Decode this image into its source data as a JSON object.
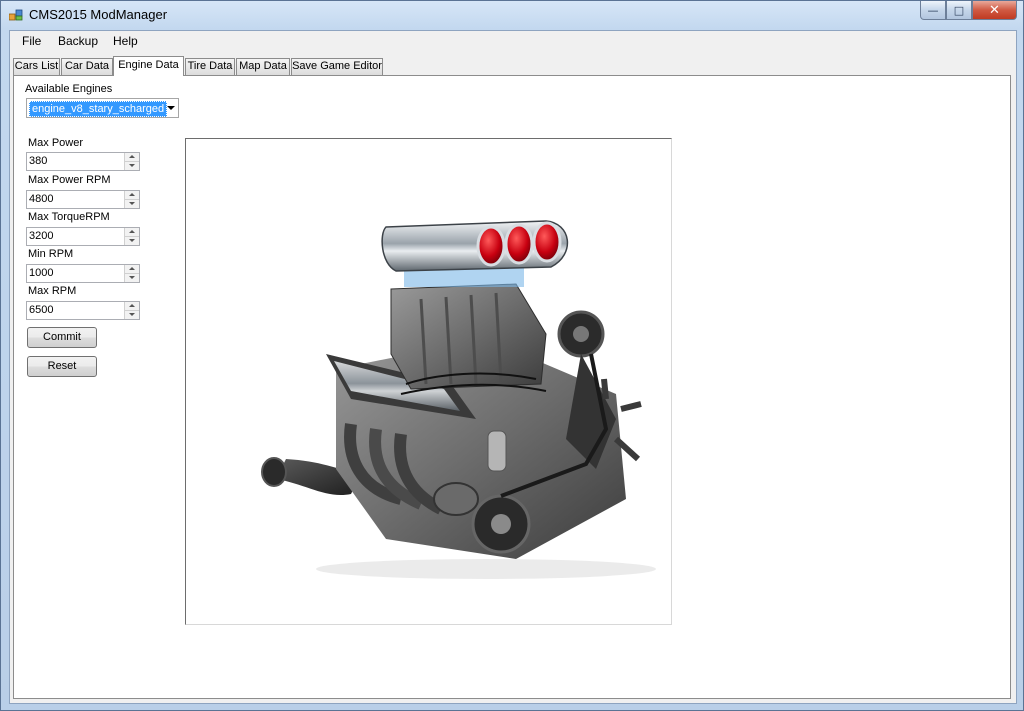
{
  "window": {
    "title": "CMS2015 ModManager"
  },
  "caption_buttons": {
    "minimize": "—",
    "maximize": "□",
    "close": "✕"
  },
  "menu": {
    "items": [
      "File",
      "Backup",
      "Help"
    ]
  },
  "tabs": [
    "Cars List",
    "Car Data",
    "Engine Data",
    "Tire Data",
    "Map Data",
    "Save Game Editor"
  ],
  "active_tab": "Engine Data",
  "engine": {
    "available_label": "Available Engines",
    "selected": "engine_v8_stary_scharged",
    "fields": [
      {
        "label": "Max Power",
        "value": "380"
      },
      {
        "label": "Max Power RPM",
        "value": "4800"
      },
      {
        "label": "Max TorqueRPM",
        "value": "3200"
      },
      {
        "label": "Min RPM",
        "value": "1000"
      },
      {
        "label": "Max RPM",
        "value": "6500"
      }
    ],
    "commit_label": "Commit",
    "reset_label": "Reset"
  },
  "icons": {
    "app": "app-icon",
    "engine_picture": "supercharged-v8-engine-image"
  }
}
